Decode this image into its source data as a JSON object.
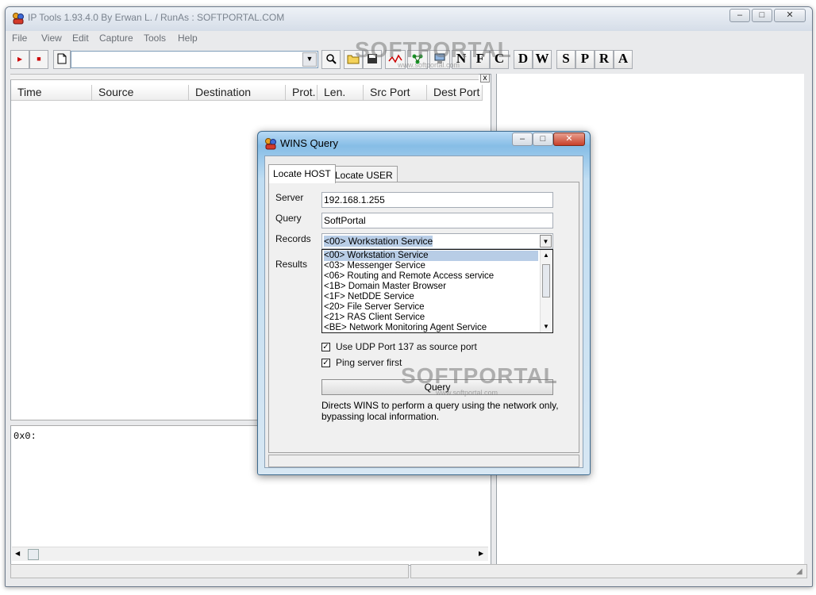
{
  "window": {
    "title": "IP Tools 1.93.4.0 By Erwan L. / RunAs : SOFTPORTAL.COM",
    "min_glyph": "–",
    "max_glyph": "□",
    "close_glyph": "✕"
  },
  "menu": [
    "File",
    "View",
    "Edit",
    "Capture",
    "Tools",
    "Help"
  ],
  "toolbar": {
    "play_glyph": "▸",
    "stop_glyph": "■",
    "combo_value": "",
    "letters": [
      "N",
      "F",
      "C",
      "D",
      "W",
      "S",
      "P",
      "R",
      "A"
    ]
  },
  "capture_table": {
    "columns": [
      "Time",
      "Source",
      "Destination",
      "Prot.",
      "Len.",
      "Src Port",
      "Dest Port"
    ],
    "close_glyph": "x"
  },
  "hex_view": {
    "text": "0x0:"
  },
  "dialog": {
    "title": "WINS Query",
    "tabs": [
      "Locate HOST",
      "Locate USER"
    ],
    "server_label": "Server",
    "server_value": "192.168.1.255",
    "query_label": "Query",
    "query_value": "SoftPortal",
    "records_label": "Records",
    "records_value": "<00> Workstation Service",
    "results_label": "Results",
    "records_options": [
      "<00> Workstation Service",
      "<03> Messenger Service",
      "<06> Routing and Remote Access service",
      "<1B> Domain Master Browser",
      "<1F> NetDDE Service",
      "<20> File Server Service",
      "<21> RAS Client Service",
      "<BE> Network Monitoring Agent Service"
    ],
    "use_udp_label": "Use UDP Port 137 as source port",
    "use_udp_checked": true,
    "ping_label": "Ping server first",
    "ping_checked": true,
    "query_button": "Query",
    "description": "Directs WINS to perform a query using the network only, bypassing local information."
  },
  "watermark": {
    "text": "SOFTPORTAL",
    "url": "www.softportal.com"
  }
}
